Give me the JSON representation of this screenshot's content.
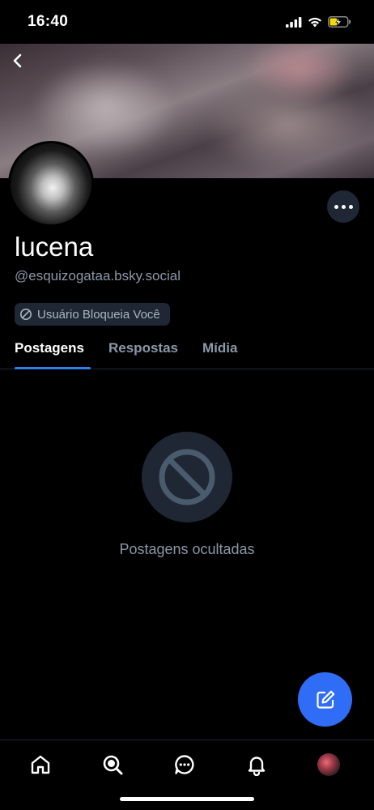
{
  "status_bar": {
    "time": "16:40",
    "icons": [
      "signal-icon",
      "wifi-icon",
      "battery-charging-icon"
    ]
  },
  "header": {
    "back_icon": "chevron-left-icon"
  },
  "profile": {
    "display_name": "lucena",
    "handle": "@esquizogataa.bsky.social",
    "blocked_badge": "Usuário Bloqueia Você",
    "blocked_icon": "block-icon",
    "more_icon": "ellipsis-icon"
  },
  "tabs": [
    {
      "label": "Postagens",
      "active": true
    },
    {
      "label": "Respostas",
      "active": false
    },
    {
      "label": "Mídia",
      "active": false
    }
  ],
  "empty_state": {
    "icon": "block-icon",
    "message": "Postagens ocultadas"
  },
  "fab": {
    "icon": "compose-icon"
  },
  "bottom_nav": {
    "items": [
      "home-icon",
      "search-icon",
      "chat-icon",
      "bell-icon",
      "profile-avatar"
    ]
  },
  "colors": {
    "background": "#000000",
    "accent": "#2f6df6",
    "tab_indicator": "#2f80ed",
    "muted_text": "#8b98a8",
    "surface": "#1e2733"
  }
}
